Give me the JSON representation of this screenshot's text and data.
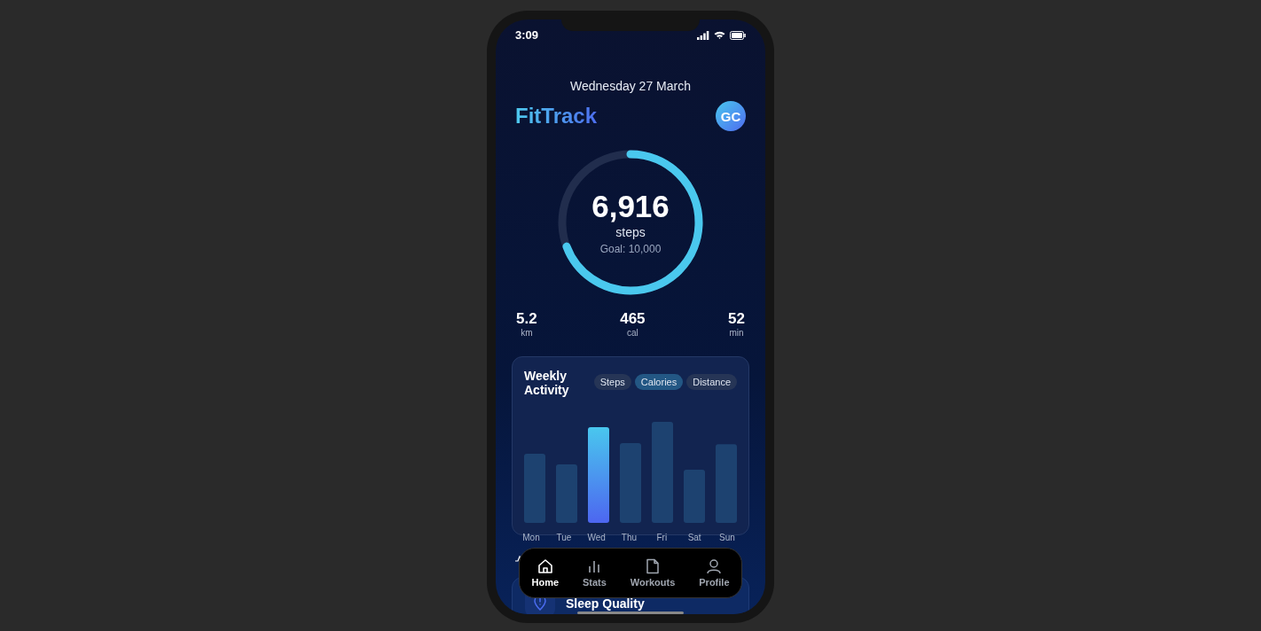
{
  "status_bar": {
    "time": "3:09"
  },
  "date": "Wednesday 27 March",
  "app_title": "FitTrack",
  "avatar": {
    "initials": "GC"
  },
  "steps_ring": {
    "value": "6,916",
    "unit": "steps",
    "goal": "Goal: 10,000",
    "level": 0.6916
  },
  "stats": [
    {
      "value": "5.2",
      "unit": "km"
    },
    {
      "value": "465",
      "unit": "cal"
    },
    {
      "value": "52",
      "unit": "min"
    }
  ],
  "weekly_activity": {
    "title": "Weekly Activity",
    "filters": [
      {
        "label": "Steps",
        "selected": false
      },
      {
        "label": "Calories",
        "selected": true
      },
      {
        "label": "Distance",
        "selected": false
      }
    ],
    "days": [
      {
        "label": "Mon",
        "level": 0.65,
        "selected": false
      },
      {
        "label": "Tue",
        "level": 0.55,
        "selected": false
      },
      {
        "label": "Wed",
        "level": 0.9,
        "selected": true
      },
      {
        "label": "Thu",
        "level": 0.75,
        "selected": false
      },
      {
        "label": "Fri",
        "level": 0.95,
        "selected": false
      },
      {
        "label": "Sat",
        "level": 0.5,
        "selected": false
      },
      {
        "label": "Sun",
        "level": 0.74,
        "selected": false
      }
    ]
  },
  "sleep_card": {
    "title": "Sleep Quality"
  },
  "bottom_nav": [
    {
      "label": "Home",
      "kind": "home",
      "selected": true
    },
    {
      "label": "Stats",
      "kind": "stats",
      "selected": false
    },
    {
      "label": "Workouts",
      "kind": "workouts",
      "selected": false
    },
    {
      "label": "Profile",
      "kind": "profile",
      "selected": false
    }
  ]
}
